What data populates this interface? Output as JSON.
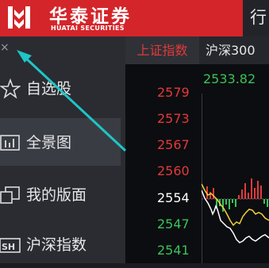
{
  "header": {
    "brand_cn": "华泰证券",
    "brand_en": "HUATAI SECURITIES",
    "top_right_label": "行"
  },
  "sidebar": {
    "close_glyph": "×",
    "items": [
      {
        "label": "自选股",
        "icon": "star-icon",
        "active": false
      },
      {
        "label": "全景图",
        "icon": "bar-chart-icon",
        "active": true
      },
      {
        "label": "我的版面",
        "icon": "layout-icon",
        "active": false
      },
      {
        "label": "沪深指数",
        "icon": "sh-index-icon",
        "active": false
      }
    ]
  },
  "tabs": [
    {
      "label": "上证指数",
      "active": true
    },
    {
      "label": "沪深300",
      "active": false
    }
  ],
  "chart": {
    "top_price": "2533.82",
    "y_labels": [
      "2579",
      "2573",
      "2567",
      "2560",
      "2554",
      "2547",
      "2541"
    ],
    "colors": {
      "up": "#e03a3a",
      "down": "#3ac25a",
      "neutral": "#ffffff"
    }
  }
}
